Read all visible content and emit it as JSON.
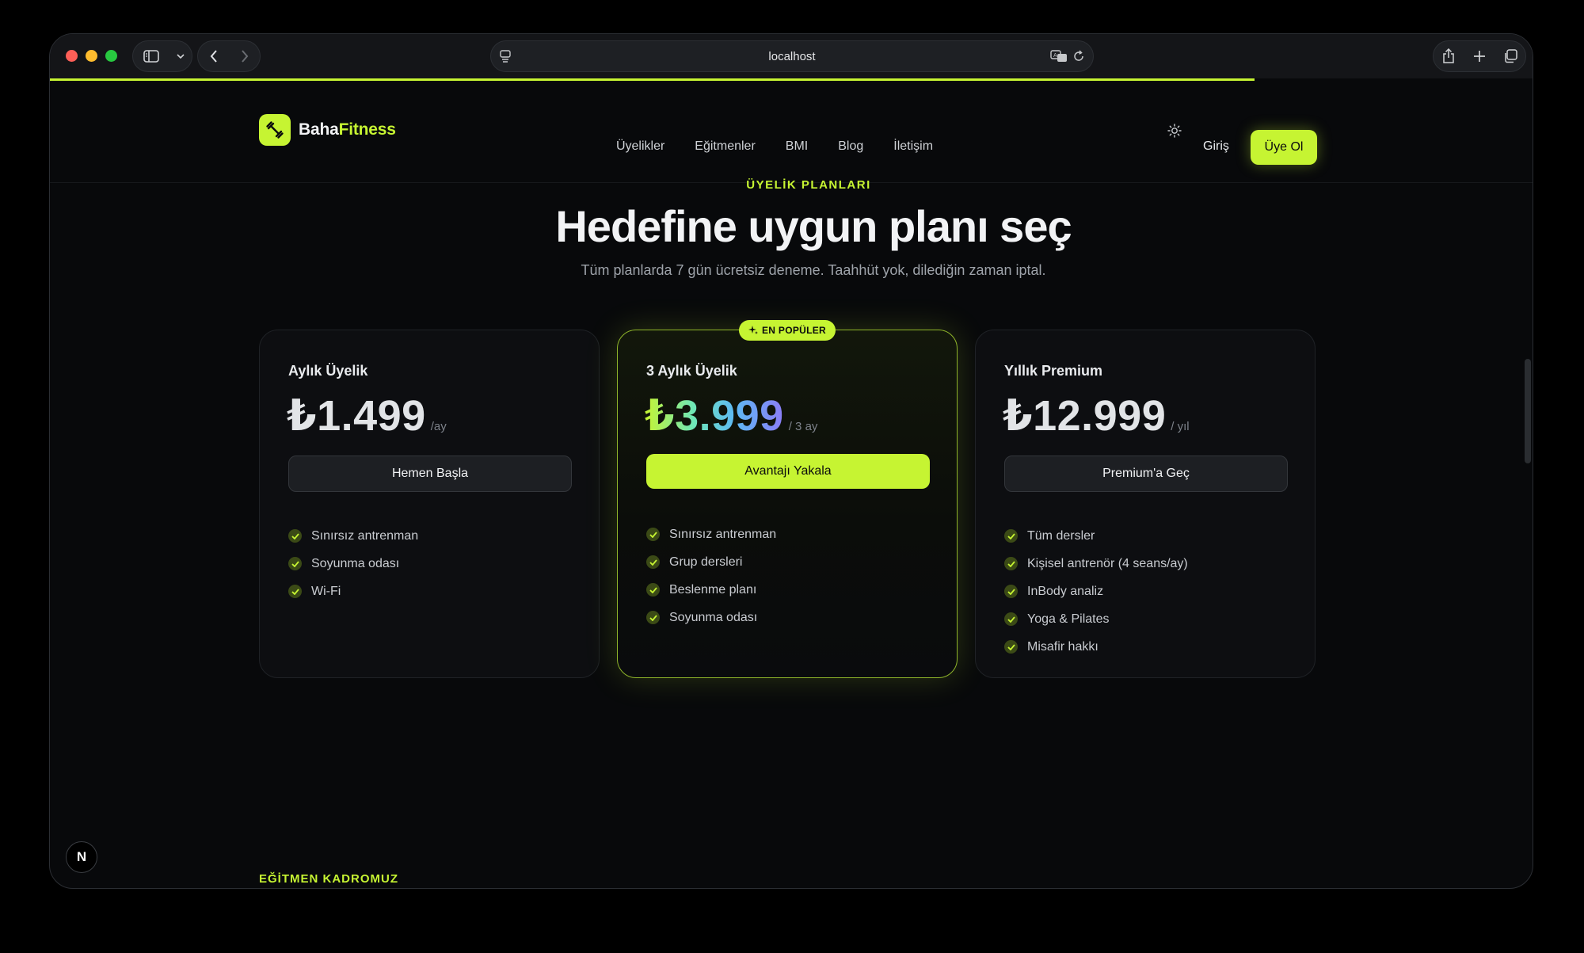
{
  "browser": {
    "url": "localhost"
  },
  "header": {
    "logo_part1": "Baha",
    "logo_part2": "Fitness",
    "nav": [
      "Üyelikler",
      "Eğitmenler",
      "BMI",
      "Blog",
      "İletişim"
    ],
    "login": "Giriş",
    "signup": "Üye Ol"
  },
  "hero": {
    "eyebrow": "ÜYELİK PLANLARI",
    "title": "Hedefine uygun planı seç",
    "subtitle": "Tüm planlarda 7 gün ücretsiz deneme. Taahhüt yok, dilediğin zaman iptal."
  },
  "plans": [
    {
      "name": "Aylık Üyelik",
      "price": "₺1.499",
      "period": "/ay",
      "cta": "Hemen Başla",
      "features": [
        "Sınırsız antrenman",
        "Soyunma odası",
        "Wi-Fi"
      ]
    },
    {
      "badge": "EN POPÜLER",
      "name": "3 Aylık Üyelik",
      "price": "₺3.999",
      "period": "/ 3 ay",
      "cta": "Avantajı Yakala",
      "features": [
        "Sınırsız antrenman",
        "Grup dersleri",
        "Beslenme planı",
        "Soyunma odası"
      ]
    },
    {
      "name": "Yıllık Premium",
      "price": "₺12.999",
      "period": "/ yıl",
      "cta": "Premium'a Geç",
      "features": [
        "Tüm dersler",
        "Kişisel antrenör (4 seans/ay)",
        "InBody analiz",
        "Yoga & Pilates",
        "Misafir hakkı"
      ]
    }
  ],
  "next_section": {
    "eyebrow": "EĞİTMEN KADROMUZ"
  },
  "dev_badge": "N",
  "colors": {
    "accent": "#c6f432",
    "background": "#08090b",
    "card": "#0d0e11"
  }
}
